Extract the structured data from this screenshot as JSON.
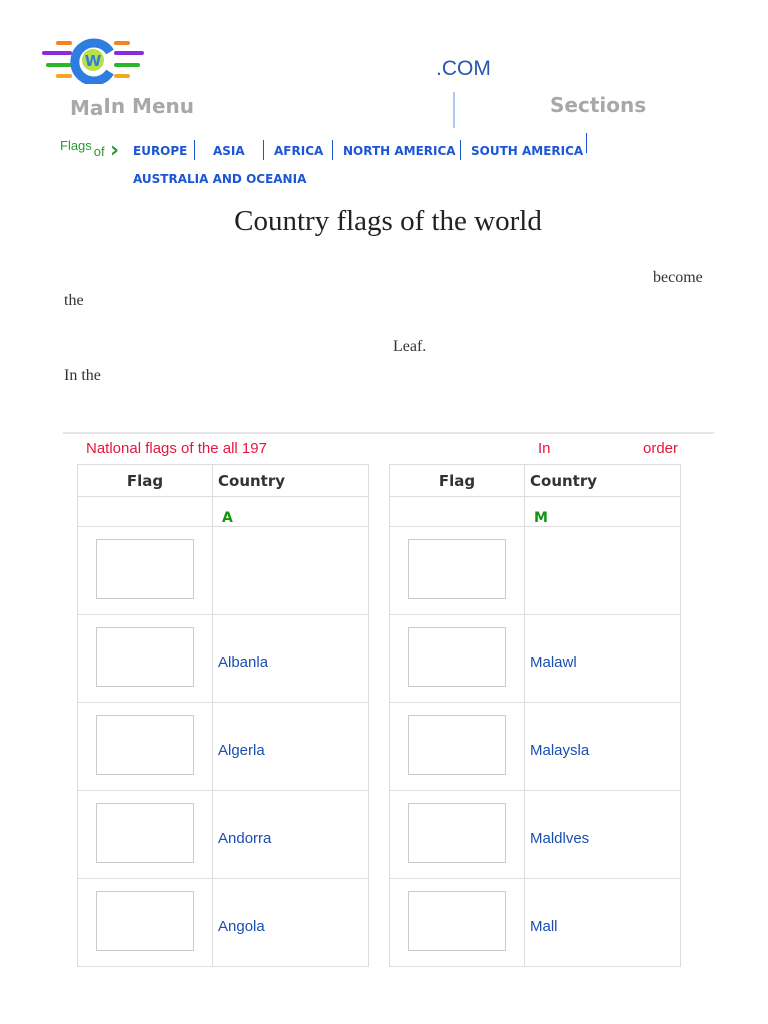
{
  "header": {
    "com": ".COM",
    "main_menu_a": "Ma",
    "main_menu_b": "In Menu",
    "sections": "Sections"
  },
  "nav": {
    "flags": "Flags",
    "of": "of",
    "items": [
      "EUROPE",
      "ASIA",
      "AFRICA",
      "NORTH AMERICA",
      "SOUTH AMERICA",
      "AUSTRALIA AND OCEANIA"
    ]
  },
  "title": "Country flags of the world",
  "para": [
    "become",
    "the",
    "Leaf.",
    "In the"
  ],
  "list_header": {
    "left": "Natlonal flags of the all 197",
    "mid": "In",
    "right": "order"
  },
  "tables": [
    {
      "col_flag": "Flag",
      "col_country": "Country",
      "letter": "A",
      "rows": [
        "",
        "Albanla",
        "Algerla",
        "Andorra",
        "Angola"
      ]
    },
    {
      "col_flag": "Flag",
      "col_country": "Country",
      "letter": "M",
      "rows": [
        "",
        "Malawl",
        "Malaysla",
        "Maldlves",
        "Mall"
      ]
    }
  ],
  "colors": {
    "link": "#1a56d6",
    "red": "#e8163c",
    "green": "#139413"
  }
}
